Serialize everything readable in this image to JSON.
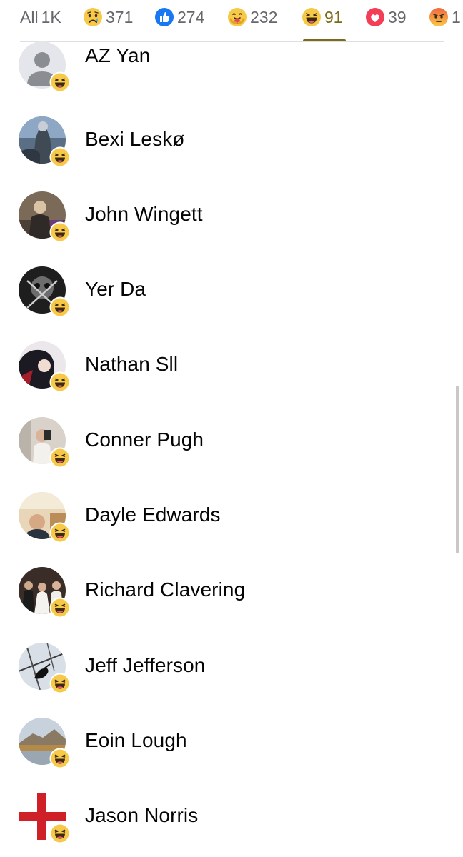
{
  "tabs": [
    {
      "label": "All",
      "count": "1K",
      "icon": null
    },
    {
      "label": "",
      "count": "371",
      "icon": "sad-reaction-icon"
    },
    {
      "label": "",
      "count": "274",
      "icon": "like-reaction-icon"
    },
    {
      "label": "",
      "count": "232",
      "icon": "care-reaction-icon"
    },
    {
      "label": "",
      "count": "91",
      "icon": "haha-reaction-icon"
    },
    {
      "label": "",
      "count": "39",
      "icon": "love-reaction-icon"
    },
    {
      "label": "",
      "count": "1",
      "icon": "angry-reaction-icon"
    }
  ],
  "active_tab": "haha",
  "reaction_badge_icon": "haha-reaction-icon",
  "people": [
    {
      "name": "AZ Yan",
      "avatar": "default-profile-picture"
    },
    {
      "name": "Bexi Leskø",
      "avatar": "profile-picture"
    },
    {
      "name": "John Wingett",
      "avatar": "profile-picture"
    },
    {
      "name": "Yer Da",
      "avatar": "profile-picture"
    },
    {
      "name": "Nathan Sll",
      "avatar": "profile-picture"
    },
    {
      "name": "Conner Pugh",
      "avatar": "profile-picture"
    },
    {
      "name": "Dayle Edwards",
      "avatar": "profile-picture"
    },
    {
      "name": "Richard Clavering",
      "avatar": "profile-picture"
    },
    {
      "name": "Jeff Jefferson",
      "avatar": "profile-picture"
    },
    {
      "name": "Eoin Lough",
      "avatar": "profile-picture"
    },
    {
      "name": "Jason Norris",
      "avatar": "profile-picture"
    }
  ],
  "colors": {
    "active_tab": "#7b6a1c",
    "inactive_tab": "#65676b",
    "name_text": "#050505"
  }
}
